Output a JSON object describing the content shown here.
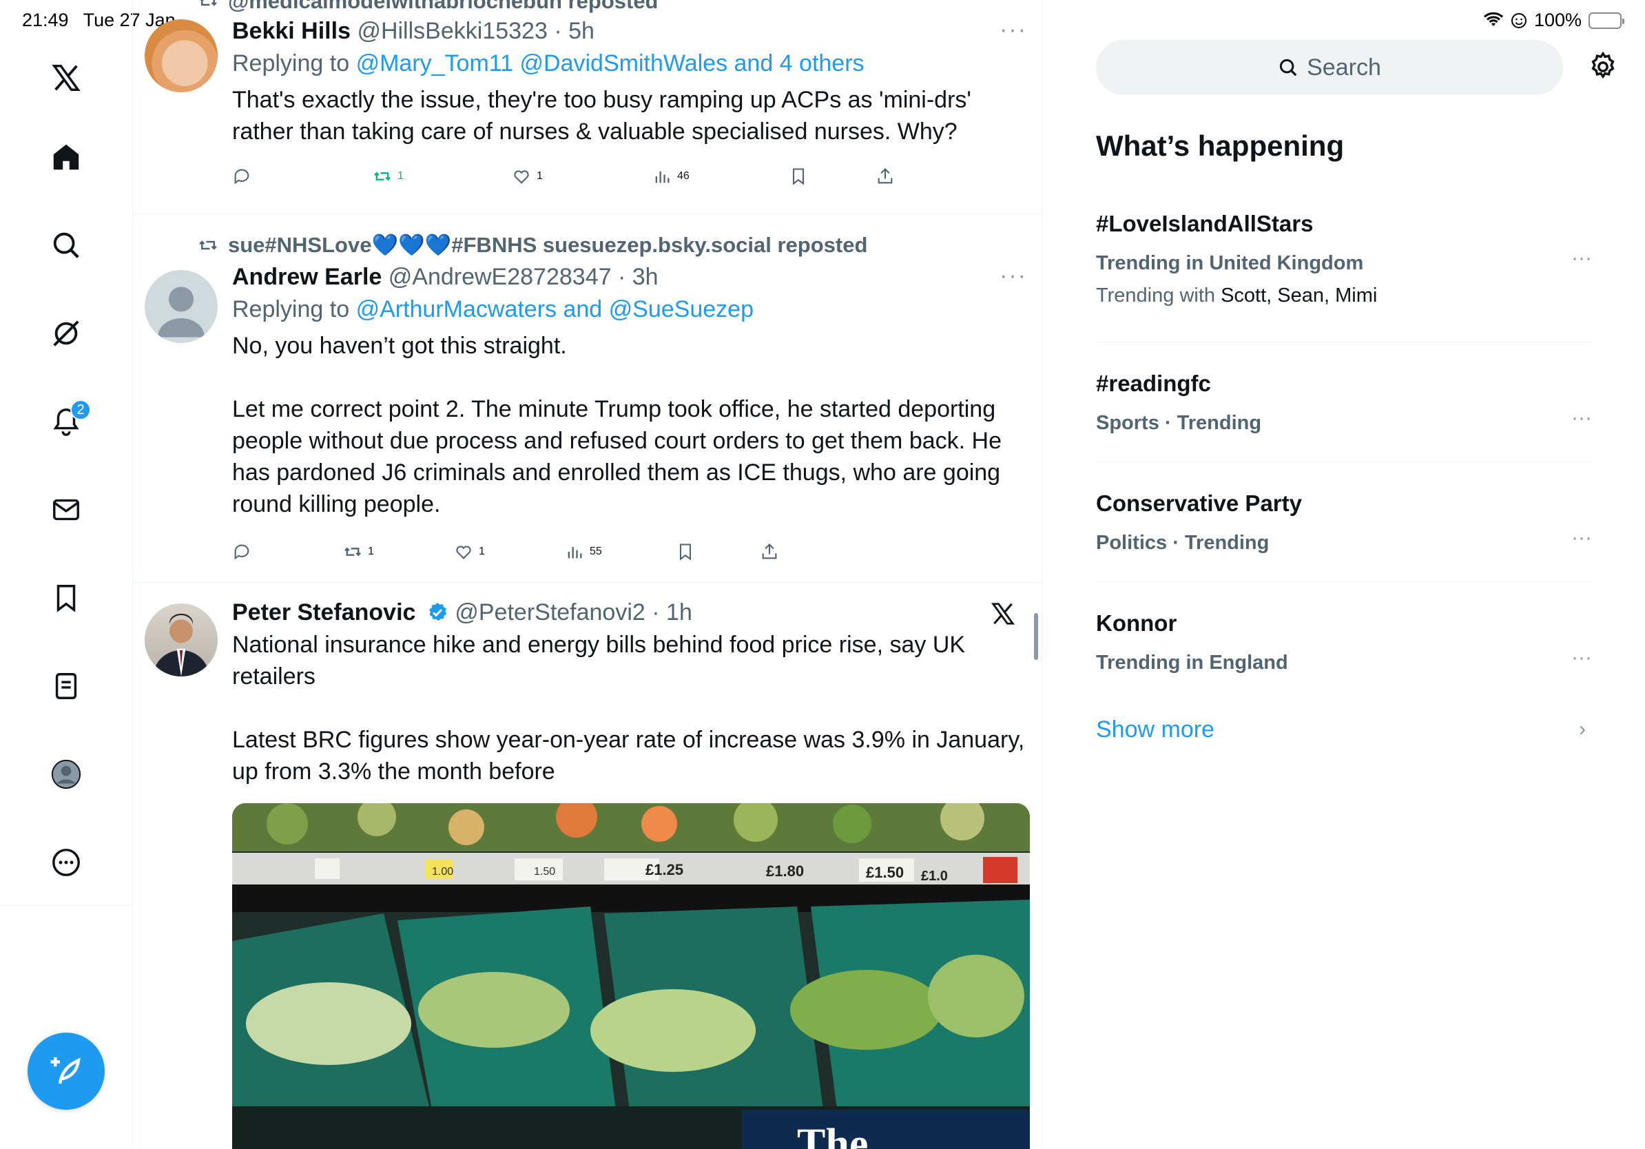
{
  "status_bar": {
    "time": "21:49",
    "date": "Tue 27 Jan",
    "battery": "100%"
  },
  "nav": {
    "items": [
      "x-logo",
      "home",
      "explore",
      "grok",
      "notifications",
      "messages",
      "bookmarks",
      "lists",
      "profile",
      "more"
    ],
    "notification_count": "2"
  },
  "timeline": {
    "top_repost_context": "@medicalmodelwithabriochebun reposted",
    "posts": [
      {
        "name": "Bekki Hills",
        "handle": "@HillsBekki15323",
        "time": "· 5h",
        "replying_prefix": "Replying to",
        "replying_to": "@Mary_Tom11 @DavidSmithWales and 4 others",
        "text": "That's exactly the issue, they're too busy ramping up ACPs as 'mini-drs' rather than taking care of nurses & valuable specialised nurses. Why?",
        "reposts": "1",
        "likes": "1",
        "views": "46",
        "more": "···"
      },
      {
        "repost_context": "sue#NHSLove💙💙💙#FBNHS suesuezep.bsky.social reposted",
        "name": "Andrew Earle",
        "handle": "@AndrewE28728347",
        "time": "· 3h",
        "replying_prefix": "Replying to",
        "replying_to": "@ArthurMacwaters and @SueSuezep",
        "text": "No, you haven’t got this straight.\n\nLet me correct point 2. The minute Trump took office, he started deporting people without due process and refused court orders to get them back. He has pardoned J6 criminals and enrolled them as ICE thugs, who are going round killing people.",
        "reposts": "1",
        "likes": "1",
        "views": "55",
        "more": "···"
      },
      {
        "name": "Peter Stefanovic",
        "handle": "@PeterStefanovi2",
        "time": "· 1h",
        "text": "National insurance hike and energy bills behind food price rise, say UK retailers\n\nLatest BRC figures show year-on-year rate of increase was 3.9% in January, up from 3.3% the month before",
        "media_caption": "The",
        "price_tags": [
          "1.00",
          "1.50",
          "£1.25",
          "£1.80",
          "£1.50",
          "£1.0"
        ]
      }
    ]
  },
  "sidebar": {
    "search_placeholder": "Search",
    "section_title": "What’s happening",
    "trends": [
      {
        "name": "#LoveIslandAllStars",
        "meta": "Trending in United Kingdom",
        "with_prefix": "Trending with",
        "with": "Scott, Sean, Mimi"
      },
      {
        "name": "#readingfc",
        "meta": "Sports · Trending"
      },
      {
        "name": "Conservative Party",
        "meta": "Politics · Trending"
      },
      {
        "name": "Konnor",
        "meta": "Trending in England"
      }
    ],
    "trend_more": "···",
    "show_more": "Show more"
  },
  "colors": {
    "accent": "#1d9bf0",
    "repost_active": "#00ba7c",
    "muted": "#536471"
  }
}
